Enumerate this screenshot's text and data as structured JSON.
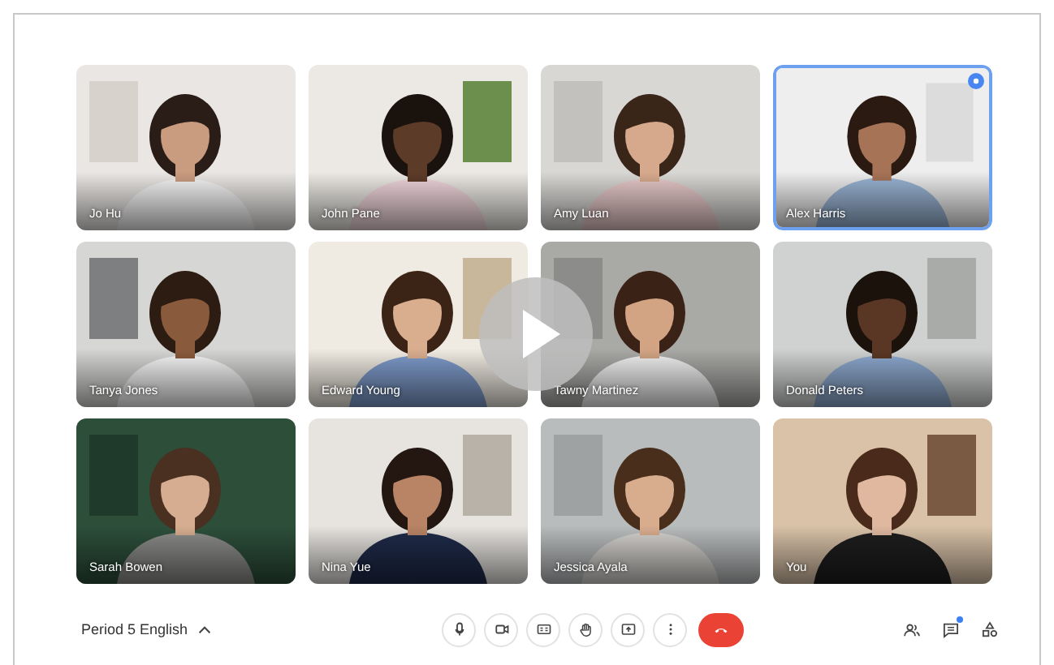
{
  "tiles": [
    {
      "name": "Jo Hu",
      "speaking": false
    },
    {
      "name": "John Pane",
      "speaking": false
    },
    {
      "name": "Amy Luan",
      "speaking": false
    },
    {
      "name": "Alex Harris",
      "speaking": true
    },
    {
      "name": "Tanya Jones",
      "speaking": false
    },
    {
      "name": "Edward Young",
      "speaking": false
    },
    {
      "name": "Tawny Martinez",
      "speaking": false
    },
    {
      "name": "Donald Peters",
      "speaking": false
    },
    {
      "name": "Sarah Bowen",
      "speaking": false
    },
    {
      "name": "Nina Yue",
      "speaking": false
    },
    {
      "name": "Jessica Ayala",
      "speaking": false
    },
    {
      "name": "You",
      "speaking": false
    }
  ],
  "meeting": {
    "title": "Period 5 English"
  },
  "controls": [
    {
      "kind": "mic"
    },
    {
      "kind": "camera"
    },
    {
      "kind": "captions"
    },
    {
      "kind": "hand"
    },
    {
      "kind": "present"
    },
    {
      "kind": "more"
    },
    {
      "kind": "end"
    }
  ],
  "side_buttons": [
    {
      "kind": "people",
      "badge": false
    },
    {
      "kind": "chat",
      "badge": true
    },
    {
      "kind": "activities",
      "badge": false
    }
  ]
}
